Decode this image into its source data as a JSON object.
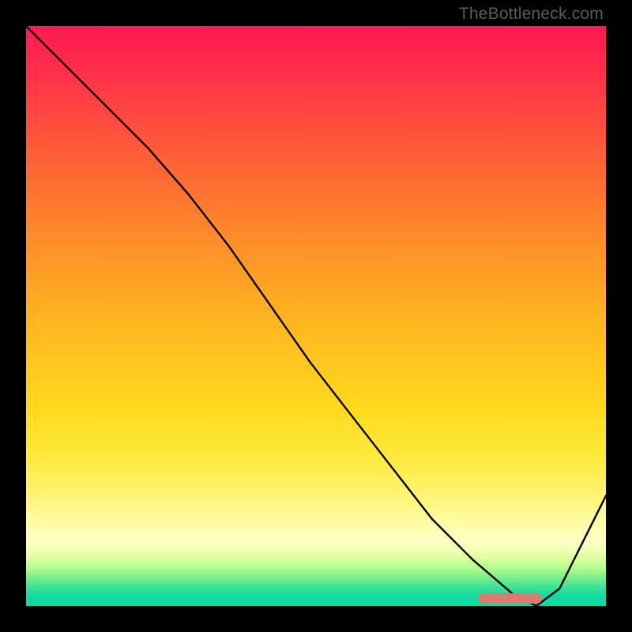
{
  "attribution": "TheBottleneck.com",
  "colors": {
    "frame_bg": "#000000",
    "curve_stroke": "#000000",
    "marker_fill": "#e0796f",
    "attribution_text": "#5b5b5b"
  },
  "chart_data": {
    "type": "line",
    "title": "",
    "subtitle": "",
    "xlabel": "",
    "ylabel": "",
    "xlim": [
      0,
      100
    ],
    "ylim": [
      0,
      100
    ],
    "grid": false,
    "legend": false,
    "x": [
      0,
      7,
      14,
      21,
      28,
      35,
      42,
      49,
      56,
      63,
      70,
      77,
      84,
      88,
      92,
      100
    ],
    "values": [
      100,
      93,
      86,
      79,
      71,
      62,
      52,
      42,
      33,
      24,
      15,
      8,
      2,
      0,
      3,
      19
    ],
    "marker": {
      "x_start": 78,
      "x_end": 89,
      "y_center": 1.3,
      "height": 1.8
    }
  }
}
